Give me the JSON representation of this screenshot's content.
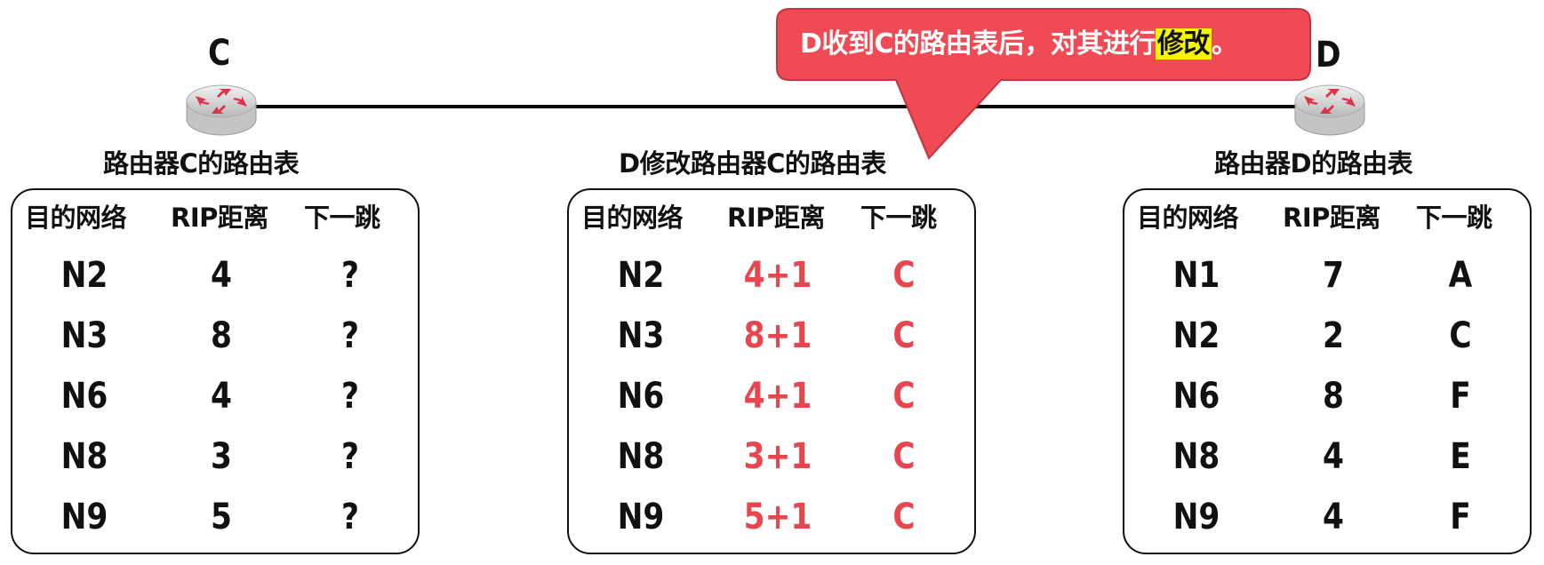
{
  "network": {
    "router_left": "C",
    "router_right": "D",
    "icon": "router-icon"
  },
  "callout": {
    "prefix": "D收到C的路由表后，对其进行",
    "highlight": "修改",
    "suffix": "。",
    "color": "#f04a55"
  },
  "tables": [
    {
      "title": "路由器C的路由表",
      "headers": [
        "目的网络",
        "RIP距离",
        "下一跳"
      ],
      "rows": [
        [
          "N2",
          "4",
          "?"
        ],
        [
          "N3",
          "8",
          "?"
        ],
        [
          "N6",
          "4",
          "?"
        ],
        [
          "N8",
          "3",
          "?"
        ],
        [
          "N9",
          "5",
          "?"
        ]
      ]
    },
    {
      "title": "D修改路由器C的路由表",
      "headers": [
        "目的网络",
        "RIP距离",
        "下一跳"
      ],
      "rows": [
        [
          "N2",
          "4+1",
          "C"
        ],
        [
          "N3",
          "8+1",
          "C"
        ],
        [
          "N6",
          "4+1",
          "C"
        ],
        [
          "N8",
          "3+1",
          "C"
        ],
        [
          "N9",
          "5+1",
          "C"
        ]
      ]
    },
    {
      "title": "路由器D的路由表",
      "headers": [
        "目的网络",
        "RIP距离",
        "下一跳"
      ],
      "rows": [
        [
          "N1",
          "7",
          "A"
        ],
        [
          "N2",
          "2",
          "C"
        ],
        [
          "N6",
          "8",
          "F"
        ],
        [
          "N8",
          "4",
          "E"
        ],
        [
          "N9",
          "4",
          "F"
        ]
      ]
    }
  ],
  "colors": {
    "modified": "#e8454f",
    "highlight": "#f5f500"
  }
}
